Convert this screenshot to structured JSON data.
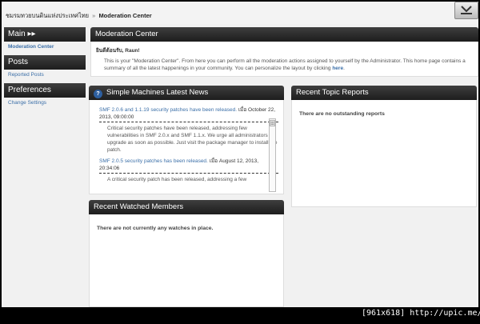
{
  "breadcrumb": {
    "forum": "ชมรมทวยบนดินแห่งประเทศไทย",
    "separator": "»",
    "current": "Moderation Center"
  },
  "sidebar": {
    "sections": [
      {
        "title": "Main ▸▸",
        "links": [
          {
            "label": "Moderation Center",
            "active": true
          }
        ]
      },
      {
        "title": "Posts",
        "links": [
          {
            "label": "Reported Posts",
            "active": false
          }
        ]
      },
      {
        "title": "Preferences",
        "links": [
          {
            "label": "Change Settings",
            "active": false
          }
        ]
      }
    ]
  },
  "main": {
    "title": "Moderation Center",
    "greeting": "ยินดีต้อนรับ, Raun!",
    "description": "This is your \"Moderation Center\". From here you can perform all the moderation actions assigned to yourself by the Administrator. This home page contains a summary of all the latest happenings in your community. You can personalize the layout by clicking",
    "description_link": "here",
    "description_end": "."
  },
  "news": {
    "title": "Simple Machines Latest News",
    "items": [
      {
        "title": "SMF 2.0.6 and 1.1.19 security patches have been released.",
        "date_prefix": "เมื่อ",
        "date": "October 22, 2013, 09:00:00",
        "body": "Critical security patches have been released, addressing few vulnerabilities in SMF 2.0.x and SMF 1.1.x. We urge all administrators to upgrade as soon as possible. Just visit the package manager to install the patch."
      },
      {
        "title": "SMF 2.0.5 security patches has been released.",
        "date_prefix": "เมื่อ",
        "date": "August 12, 2013, 20:34:06",
        "body": "A critical security patch has been released, addressing a few"
      }
    ]
  },
  "reports": {
    "title": "Recent Topic Reports",
    "empty": "There are no outstanding reports"
  },
  "watched": {
    "title": "Recent Watched Members",
    "empty": "There are not currently any watches in place."
  },
  "footer": {
    "stamp": "[961x618] http://upic.me/"
  }
}
